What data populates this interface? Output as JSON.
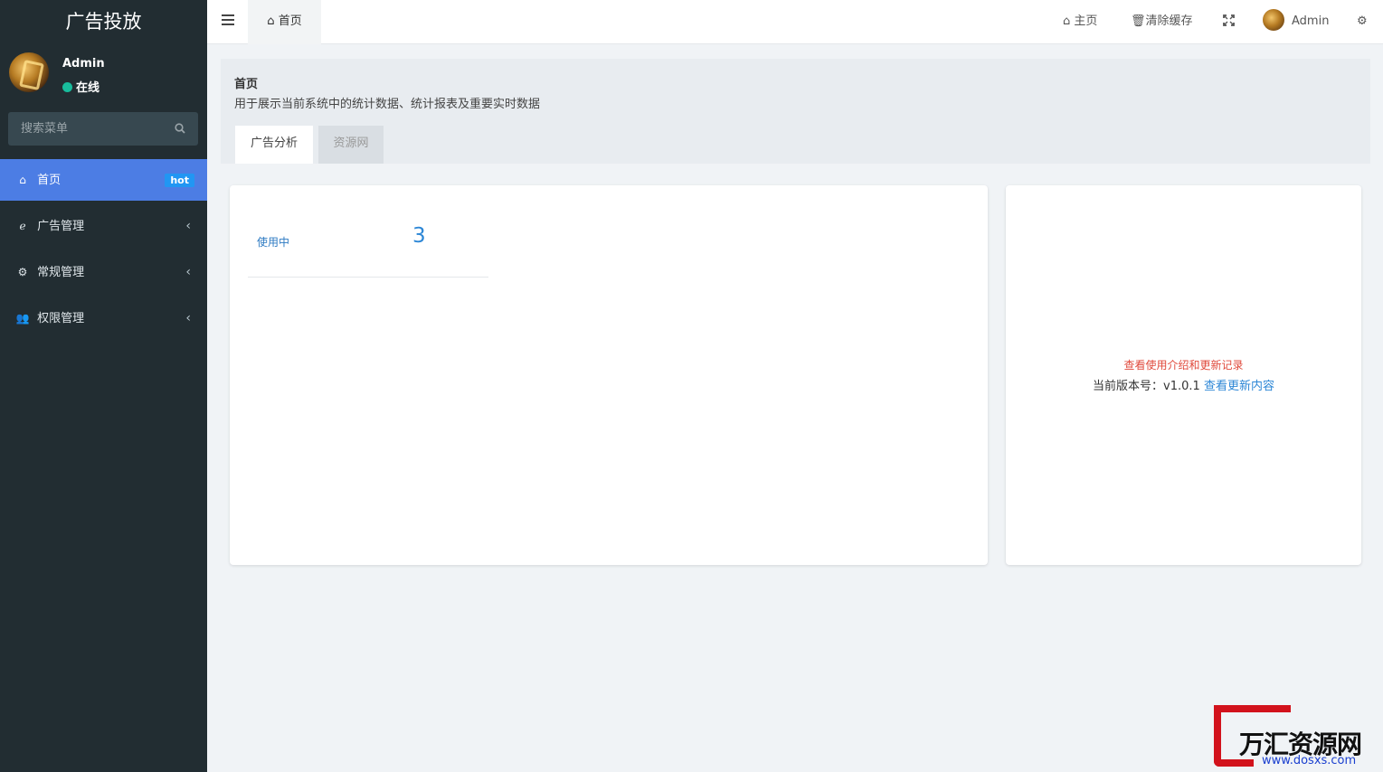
{
  "sidebar": {
    "logo_text": "广告投放",
    "user": {
      "name": "Admin",
      "status": "在线"
    },
    "search": {
      "placeholder": "搜索菜单"
    },
    "items": [
      {
        "label": "首页",
        "icon": "home-icon",
        "badge": "hot",
        "active": true
      },
      {
        "label": "广告管理",
        "icon": "internet-explorer-icon"
      },
      {
        "label": "常规管理",
        "icon": "cogs-icon"
      },
      {
        "label": "权限管理",
        "icon": "group-icon"
      }
    ]
  },
  "header": {
    "tab_label": "首页",
    "links": {
      "home": "主页",
      "clear_cache": "清除缓存",
      "admin": "Admin"
    }
  },
  "page": {
    "title": "首页",
    "description": "用于展示当前系统中的统计数据、统计报表及重要实时数据",
    "tabs": [
      "广告分析",
      "资源网"
    ]
  },
  "stats": {
    "label": "使用中",
    "value": "3"
  },
  "info": {
    "link_text": "查看使用介绍和更新记录",
    "version_prefix": "当前版本号：v1.0.1 ",
    "version_link": "查看更新内容"
  },
  "watermark": {
    "text": "万汇资源网",
    "url": "www.dosxs.com"
  },
  "colors": {
    "sidebar_bg": "#222d32",
    "active_item": "#4c7de4",
    "badge": "#2196f3",
    "online": "#18bc9c",
    "link_blue": "#2d87d6",
    "link_red": "#e04a3c"
  }
}
